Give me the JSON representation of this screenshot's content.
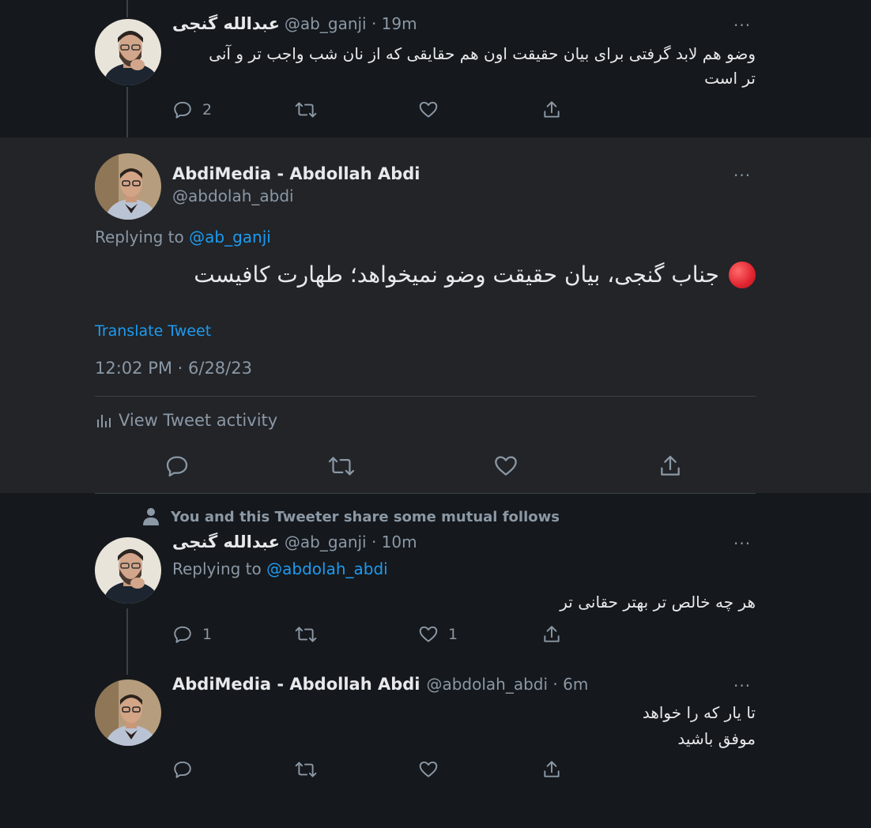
{
  "colors": {
    "background": "#15181c",
    "focused_background": "#222428",
    "link": "#1d9bf0",
    "muted": "#8b98a5",
    "text": "#e7e9ea",
    "red_dot": "#e0242f"
  },
  "tweets": [
    {
      "name": "عبدالله گنجی",
      "meta": "@ab_ganji · 19m",
      "more": "···",
      "text_lines": [
        "وضو هم لابد گرفتی برای بیان حقیقت  اون هم حقایقی که از نان شب واجب تر و آنی",
        "تر است"
      ],
      "reply_count": "2",
      "retweet_count": "",
      "like_count": ""
    }
  ],
  "focused": {
    "name": "AbdiMedia - Abdollah Abdi",
    "handle": "@abdolah_abdi",
    "more": "···",
    "replying_prefix": "Replying to ",
    "replying_to": "@ab_ganji",
    "text": "جناب گنجی، بیان حقیقت وضو نمیخواهد؛ طهارت کافیست",
    "translate": "Translate Tweet",
    "timestamp": "12:02 PM · 6/28/23",
    "activity": "View Tweet activity"
  },
  "mutual_note": "You and this Tweeter share some mutual follows",
  "replies": [
    {
      "name": "عبدالله گنجی",
      "meta": "@ab_ganji · 10m",
      "more": "···",
      "replying_prefix": "Replying to ",
      "replying_to": "@abdolah_abdi",
      "text": "هر چه خالص تر بهتر حقانی تر",
      "reply_count": "1",
      "like_count": "1"
    },
    {
      "name": "AbdiMedia - Abdollah Abdi",
      "meta": "@abdolah_abdi · 6m",
      "more": "···",
      "text_lines": [
        "تا یار که را خواهد",
        "موفق باشید"
      ],
      "reply_count": "",
      "like_count": ""
    }
  ]
}
